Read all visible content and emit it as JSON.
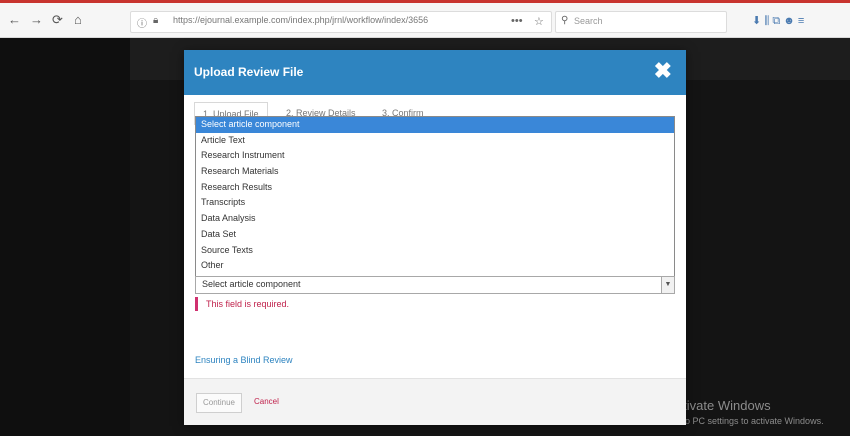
{
  "browser": {
    "back_glyph": "←",
    "forward_glyph": "→",
    "reload_glyph": "⟳",
    "home_glyph": "⌂",
    "url": "https://ejournal.example.com/index.php/jrnl/workflow/index/3656",
    "search_placeholder": "Search",
    "menu_dots": "•••",
    "star_glyph": "☆",
    "toolbar_icons": "⬇ ⫼ ⧉ ☻ ≡"
  },
  "modal": {
    "title": "Upload Review File",
    "close_glyph": "✖",
    "tabs": [
      "1. Upload File",
      "2. Review Details",
      "3. Confirm"
    ],
    "options": [
      "Select article component",
      "Article Text",
      "Research Instrument",
      "Research Materials",
      "Research Results",
      "Transcripts",
      "Data Analysis",
      "Data Set",
      "Source Texts",
      "Other"
    ],
    "selected_option_index": 0,
    "select_value": "Select article component",
    "error_text": "This field is required.",
    "ack_link": "Ensuring a Blind Review",
    "submit_label": "Continue",
    "cancel_label": "Cancel"
  },
  "os_watermark": {
    "line1": "Activate Windows",
    "line2": "Go to PC settings to activate Windows."
  },
  "colors": {
    "modal_header": "#2e84c0",
    "selected_option": "#3a87d8",
    "error": "#c0224c",
    "browser_accent": "#c8342f"
  }
}
